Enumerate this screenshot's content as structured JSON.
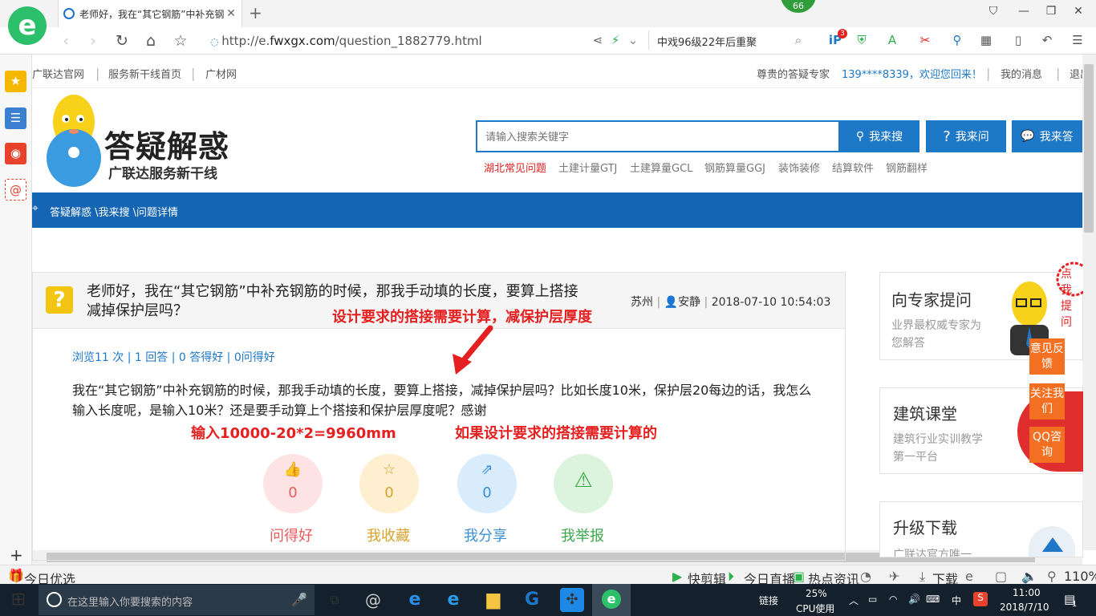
{
  "browser": {
    "tab_title": "老师好，我在“其它钢筋”中补充钢",
    "badge_count": "66",
    "url_prefix": "http://e.",
    "url_domain": "fwxgx.com",
    "url_path": "/question_1882779.html",
    "news_text": "中戏96级22年后重聚",
    "sidebar_badge": "3"
  },
  "site_top": {
    "links": [
      "广联达官网",
      "服务新干线首页",
      "广材网"
    ],
    "expert_label": "尊贵的答疑专家",
    "welcome": "139****8339，欢迎您回来！",
    "messages": "我的消息",
    "logout": "退出"
  },
  "header": {
    "brand": "答疑解惑",
    "brand_sub": "广联达服务新干线",
    "search_placeholder": "请输入搜索关键字",
    "btn_search": "我来搜",
    "btn_ask": "我来问",
    "btn_answer": "我来答",
    "hot_links": [
      "湖北常见问题",
      "土建计量GTJ",
      "土建算量GCL",
      "钢筋算量GGJ",
      "装饰装修",
      "结算软件",
      "钢筋翻样"
    ]
  },
  "breadcrumb": "答疑解惑 \\我来搜 \\问题详情",
  "question": {
    "title": "老师好，我在“其它钢筋”中补充钢筋的时候，那我手动填的长度，要算上搭接减掉保护层吗？",
    "location": "苏州",
    "user": "安静",
    "datetime": "2018-07-10 10:54:03",
    "stats": "浏览11 次 | 1 回答 | 0 答得好 | 0问得好",
    "body": "我在“其它钢筋”中补充钢筋的时候，那我手动填的长度，要算上搭接，减掉保护层吗？比如长度10米，保护层20每边的话，我怎么输入长度呢，是输入10米？还是要手动算上个搭接和保护层厚度呢？感谢"
  },
  "annotations": {
    "note1": "设计要求的搭接需要计算，减保护层厚度",
    "note2": "输入10000-20*2=9960mm",
    "note3": "如果设计要求的搭接需要计算的"
  },
  "actions": [
    {
      "label": "问得好",
      "count": "0",
      "color": "#e95a5a",
      "bg": "#fde3e3"
    },
    {
      "label": "我收藏",
      "count": "0",
      "color": "#d9a22b",
      "bg": "#fdefcf"
    },
    {
      "label": "我分享",
      "count": "0",
      "color": "#3a8fd8",
      "bg": "#d8ecfb"
    },
    {
      "label": "我举报",
      "count": "",
      "color": "#3aa84a",
      "bg": "#dcf3de"
    }
  ],
  "right": {
    "card1_title": "向专家提问",
    "card1_sub": "业界最权威专家为您解答",
    "card2_title": "建筑课堂",
    "card2_sub": "建筑行业实训教学第一平台",
    "card3_title": "升级下载",
    "card3_sub": "广联达官方唯一",
    "float_feedback": "意见反馈",
    "float_follow": "关注我们",
    "float_qq": "QQ咨询",
    "bubble": "点我提问"
  },
  "statusbar": {
    "left": "今日优选",
    "items": [
      "快剪辑",
      "今日直播",
      "热点资讯",
      "下载"
    ],
    "zoom": "110%"
  },
  "taskbar": {
    "search_placeholder": "在这里输入你要搜索的内容",
    "link": "链接",
    "cpu_pct": "25%",
    "cpu_label": "CPU使用",
    "ime": "中",
    "time": "11:00",
    "date": "2018/7/10",
    "notif": "1"
  }
}
